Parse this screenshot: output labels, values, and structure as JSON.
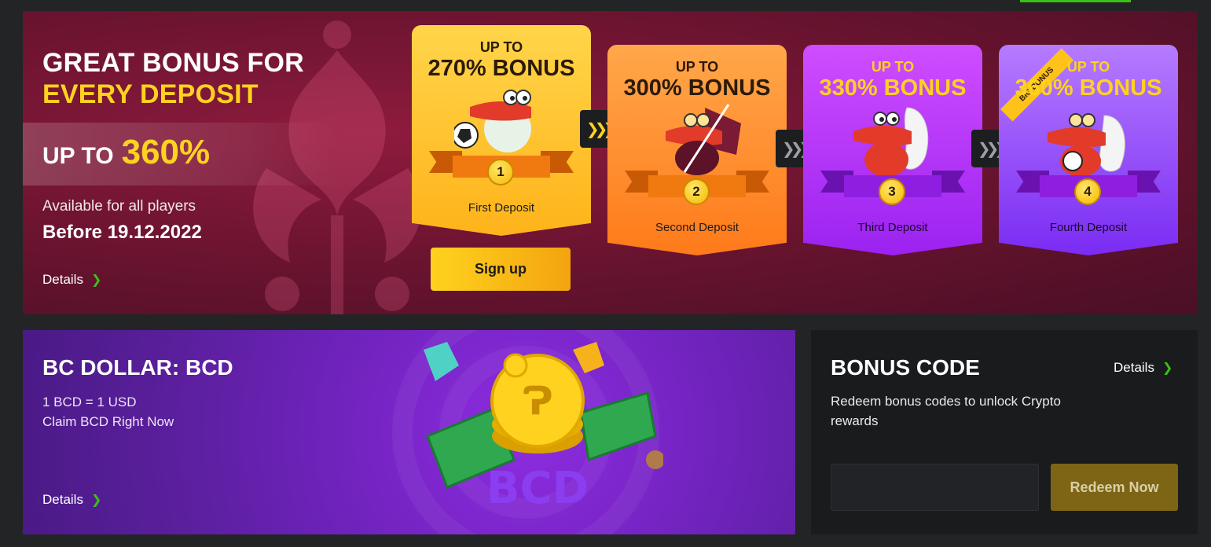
{
  "hero": {
    "title_line1": "GREAT BONUS FOR",
    "title_line2": "EVERY DEPOSIT",
    "upto_prefix": "UP TO",
    "upto_value": "360%",
    "available": "Available for all players",
    "deadline": "Before 19.12.2022",
    "details": "Details",
    "signup_label": "Sign up"
  },
  "deposits": [
    {
      "upto": "UP TO",
      "bonus": "270% BONUS",
      "number": "1",
      "label": "First Deposit"
    },
    {
      "upto": "UP TO",
      "bonus": "300% BONUS",
      "number": "2",
      "label": "Second Deposit"
    },
    {
      "upto": "UP TO",
      "bonus": "330% BONUS",
      "number": "3",
      "label": "Third Deposit"
    },
    {
      "upto": "UP TO",
      "bonus": "360% BONUS",
      "number": "4",
      "label": "Fourth Deposit",
      "tag": "BIG BONUS"
    }
  ],
  "bcd": {
    "title": "BC DOLLAR: BCD",
    "rate": "1 BCD = 1 USD",
    "claim": "Claim BCD Right Now",
    "details": "Details",
    "art_text": "BCD"
  },
  "bonus_code": {
    "title": "BONUS CODE",
    "details": "Details",
    "description": "Redeem bonus codes to unlock Crypto rewards",
    "input_value": "",
    "redeem_label": "Redeem Now"
  },
  "colors": {
    "accent_yellow": "#ffd21f",
    "accent_green": "#3bc117",
    "hero_bg": "#6e1431",
    "bcd_bg": "#6a22b5",
    "panel_bg": "#1a1b1d"
  }
}
